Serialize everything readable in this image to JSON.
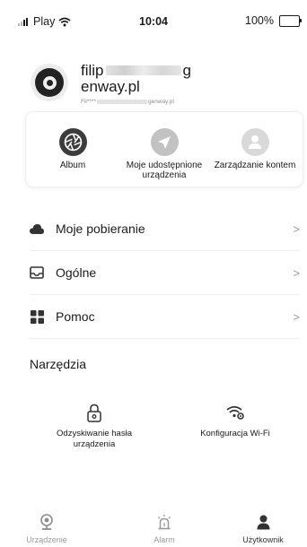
{
  "status_bar": {
    "carrier": "Play",
    "time": "10:04",
    "battery": "100%",
    "battery_level": 1.0
  },
  "profile": {
    "name_start": "filip",
    "name_end": "g",
    "domain": "enway.pl",
    "email_start": "Fil****",
    "email_end": "genway.pl"
  },
  "quick_actions": [
    {
      "label": "Album",
      "icon": "aperture-icon"
    },
    {
      "label": "Moje udostępnione urządzenia",
      "icon": "send-icon"
    },
    {
      "label": "Zarządzanie kontem",
      "icon": "user-icon"
    }
  ],
  "menu": [
    {
      "label": "Moje pobieranie",
      "icon": "cloud-icon"
    },
    {
      "label": "Ogólne",
      "icon": "inbox-icon"
    },
    {
      "label": "Pomoc",
      "icon": "grid-icon"
    }
  ],
  "chevron": ">",
  "tools_section": {
    "title": "Narzędzia",
    "items": [
      {
        "label": "Odzyskiwanie hasła urządzenia",
        "icon": "lock-icon"
      },
      {
        "label": "Konfiguracja Wi-Fi",
        "icon": "wifi-settings-icon"
      }
    ]
  },
  "tab_bar": {
    "items": [
      {
        "label": "Urządzenie",
        "icon": "camera-icon",
        "active": false
      },
      {
        "label": "Alarm",
        "icon": "alarm-icon",
        "active": false
      },
      {
        "label": "Użytkownik",
        "icon": "user-icon",
        "active": true
      }
    ]
  },
  "colors": {
    "text": "#1a1a1a",
    "muted": "#9a9a9a",
    "divider": "#ededed"
  }
}
